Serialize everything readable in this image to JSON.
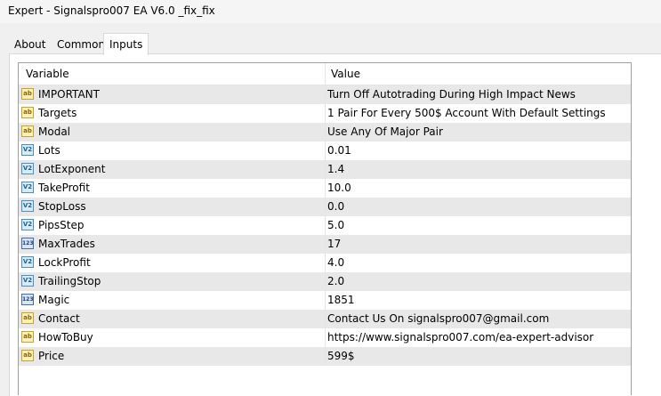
{
  "window": {
    "title": "Expert - Signalspro007 EA V6.0 _fix_fix"
  },
  "tabs": [
    {
      "label": "About",
      "active": false
    },
    {
      "label": "Common",
      "active": false
    },
    {
      "label": "Inputs",
      "active": true
    }
  ],
  "table": {
    "columns": [
      "Variable",
      "Value"
    ],
    "rows": [
      {
        "icon": "ab",
        "variable": "IMPORTANT",
        "value": " Turn Off Autotrading During High Impact News"
      },
      {
        "icon": "ab",
        "variable": "Targets",
        "value": " 1 Pair For Every 500$ Account With Default Settings"
      },
      {
        "icon": "ab",
        "variable": "Modal",
        "value": "Use Any Of Major Pair"
      },
      {
        "icon": "v2",
        "variable": "Lots",
        "value": "0.01"
      },
      {
        "icon": "v2",
        "variable": "LotExponent",
        "value": "1.4"
      },
      {
        "icon": "v2",
        "variable": "TakeProfit",
        "value": "10.0"
      },
      {
        "icon": "v2",
        "variable": "StopLoss",
        "value": "0.0"
      },
      {
        "icon": "v2",
        "variable": "PipsStep",
        "value": "5.0"
      },
      {
        "icon": "123",
        "variable": "MaxTrades",
        "value": "17"
      },
      {
        "icon": "v2",
        "variable": "LockProfit",
        "value": "4.0"
      },
      {
        "icon": "v2",
        "variable": "TrailingStop",
        "value": "2.0"
      },
      {
        "icon": "123",
        "variable": "Magic",
        "value": "1851"
      },
      {
        "icon": "ab",
        "variable": "Contact",
        "value": "Contact Us On signalspro007@gmail.com"
      },
      {
        "icon": "ab",
        "variable": "HowToBuy",
        "value": "https://www.signalspro007.com/ea-expert-advisor"
      },
      {
        "icon": "ab",
        "variable": "Price",
        "value": "599$"
      }
    ]
  }
}
